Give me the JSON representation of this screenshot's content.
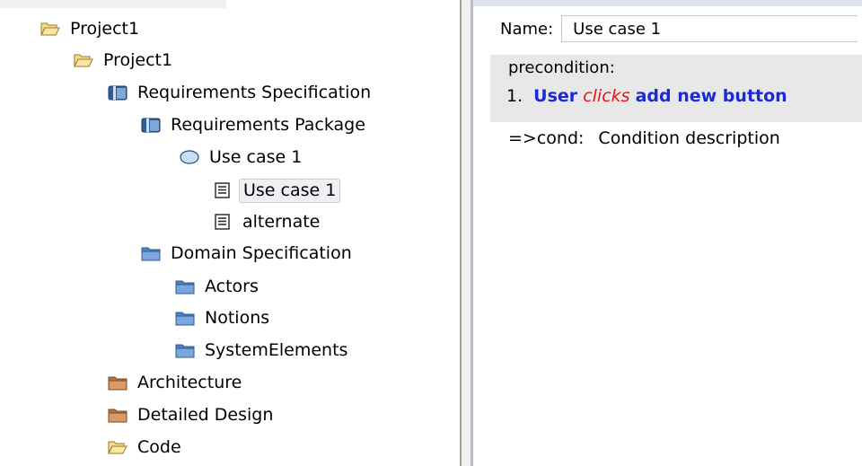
{
  "tree": {
    "root": {
      "label": "Project1",
      "icon": "open-folder-icon"
    },
    "project": {
      "label": "Project1",
      "icon": "open-folder-icon"
    },
    "requirements_spec": {
      "label": "Requirements Specification",
      "icon": "package-folder-icon"
    },
    "requirements_package": {
      "label": "Requirements Package",
      "icon": "package-folder-icon"
    },
    "use_case_node": {
      "label": "Use case 1",
      "icon": "use-case-oval-icon"
    },
    "use_case_scenario": {
      "label": "Use case 1",
      "icon": "document-icon",
      "selected": true
    },
    "alternate_scenario": {
      "label": "alternate",
      "icon": "document-icon"
    },
    "domain_spec": {
      "label": "Domain Specification",
      "icon": "blue-folder-icon"
    },
    "actors": {
      "label": "Actors",
      "icon": "blue-folder-icon"
    },
    "notions": {
      "label": "Notions",
      "icon": "blue-folder-icon"
    },
    "system_elements": {
      "label": "SystemElements",
      "icon": "blue-folder-icon"
    },
    "architecture": {
      "label": "Architecture",
      "icon": "brown-folder-icon"
    },
    "detailed_design": {
      "label": "Detailed Design",
      "icon": "brown-folder-icon"
    },
    "code": {
      "label": "Code",
      "icon": "open-folder-icon"
    }
  },
  "editor": {
    "name_label": "Name:",
    "name_value": "Use case 1",
    "precondition_label": "precondition:",
    "step": {
      "number": "1.",
      "subject": "User",
      "verb": "clicks",
      "object": "add new button"
    },
    "cond": {
      "key": "=>cond:",
      "value": "Condition description"
    }
  },
  "colors": {
    "keyword_blue": "#1a2ad6",
    "verb_red": "#e8141a",
    "precondition_bg": "#e8e8e8",
    "selection_bg": "#eef0f3"
  }
}
